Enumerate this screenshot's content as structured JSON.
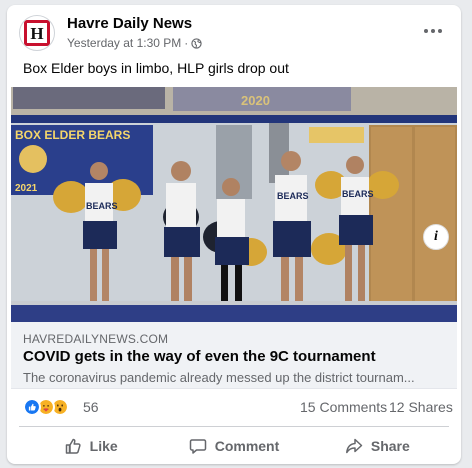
{
  "post": {
    "page_name": "Havre Daily News",
    "timestamp": "Yesterday at 1:30 PM",
    "separator": "·",
    "audience_icon": "globe-icon",
    "text": "Box Elder boys in limbo, HLP girls drop out"
  },
  "link": {
    "domain": "HAVREDAILYNEWS.COM",
    "title": "COVID gets in the way of even the 9C tournament",
    "description": "The coronavirus pandemic already messed up the district tournam..."
  },
  "image": {
    "banner_text": "BOX ELDER BEARS",
    "banner_year": "2021",
    "jersey_text": "BEARS"
  },
  "engagement": {
    "reaction_icons": [
      "like-icon",
      "care-icon",
      "wow-icon"
    ],
    "reaction_count": "56",
    "comments": "15 Comments",
    "shares": "12 Shares"
  },
  "actions": {
    "like": "Like",
    "comment": "Comment",
    "share": "Share"
  },
  "colors": {
    "accent": "#1877f2",
    "logo_red": "#c8102e",
    "secondary_text": "#65676b"
  }
}
